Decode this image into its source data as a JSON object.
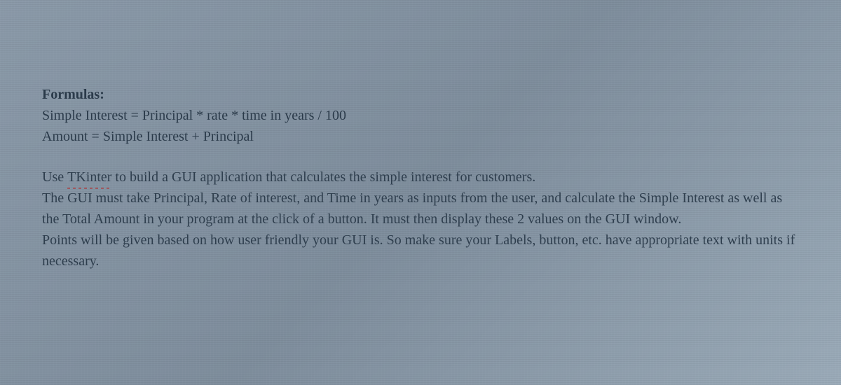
{
  "formulas": {
    "heading": "Formulas:",
    "line1": "Simple Interest = Principal * rate * time in years / 100",
    "line2": "Amount = Simple Interest + Principal"
  },
  "instructions": {
    "p1_prefix": "Use ",
    "p1_tk": "TKinter",
    "p1_rest": " to build a GUI application that calculates the simple interest for customers.",
    "p2": "The GUI must take Principal, Rate of interest, and Time in years as inputs from the user, and calculate the Simple Interest as well as the Total Amount in your program at the click of a button. It must then display these 2 values on the GUI window.",
    "p3": "Points will be given based on how user friendly your GUI is. So make sure your Labels, button, etc. have appropriate text with units if necessary."
  }
}
